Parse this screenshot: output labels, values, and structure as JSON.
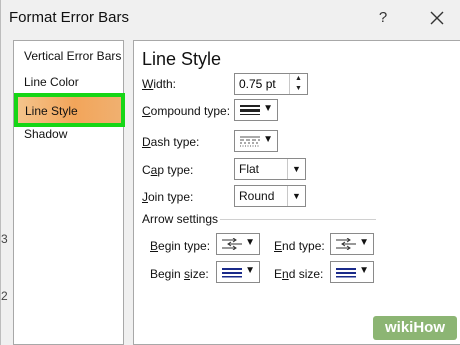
{
  "window": {
    "title": "Format Error Bars",
    "help": "?"
  },
  "nav": {
    "items": [
      {
        "label": "Vertical Error Bars"
      },
      {
        "label": "Line Color"
      },
      {
        "label": "Line Style",
        "selected": true
      },
      {
        "label": "Shadow"
      }
    ]
  },
  "line_style": {
    "heading": "Line Style",
    "width": {
      "label_key": "W",
      "label_rest": "idth:",
      "value": "0.75 pt"
    },
    "compound": {
      "label_key": "C",
      "label_rest": "ompound type:",
      "icon": "compound-lines-icon"
    },
    "dash": {
      "label_key": "D",
      "label_rest": "ash type:",
      "icon": "dash-pattern-icon"
    },
    "cap": {
      "label_pre": "C",
      "label_key": "a",
      "label_rest": "p type:",
      "value": "Flat"
    },
    "join": {
      "label_key": "J",
      "label_rest": "oin type:",
      "value": "Round"
    }
  },
  "arrow_settings": {
    "heading": "Arrow settings",
    "begin_type": {
      "label_key": "B",
      "label_rest": "egin type:",
      "icon": "arrow-type-icon"
    },
    "end_type": {
      "label_key": "E",
      "label_rest": "nd type:",
      "icon": "arrow-type-icon"
    },
    "begin_size": {
      "label_pre": "Begin ",
      "label_key": "s",
      "label_rest": "ize:",
      "icon": "arrow-size-icon"
    },
    "end_size": {
      "label_pre": "E",
      "label_key": "n",
      "label_rest": "d size:",
      "icon": "arrow-size-icon"
    }
  },
  "background": {
    "left_markers": [
      "3",
      "2"
    ]
  },
  "watermark": {
    "text": "wikiHow"
  },
  "colors": {
    "selection_border": "#16d616",
    "selection_fill": "#f2a55a",
    "watermark_bg": "#78a85a"
  }
}
